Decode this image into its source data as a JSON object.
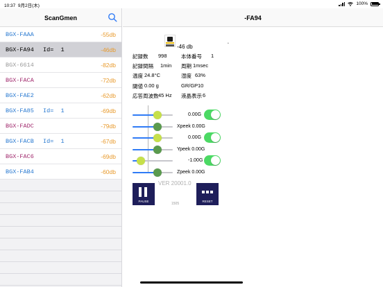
{
  "status_bar": {
    "time": "10:37",
    "date": "9月2日(木)",
    "battery": "100%",
    "wifi_icon": "wifi-icon",
    "signal_icon": "signal-icon",
    "battery_icon": "battery-icon"
  },
  "sidebar": {
    "title": "ScanGmen",
    "search_icon": "search-icon",
    "devices": [
      {
        "name": "BGX-FAAA",
        "id": "",
        "signal": "-55db",
        "color": "#2a7ad1",
        "selected": false
      },
      {
        "name": "BGX-FA94",
        "id": "Id=  1",
        "signal": "-46db",
        "color": "#000000",
        "selected": true
      },
      {
        "name": "BGX-6614",
        "id": "",
        "signal": "-82db",
        "color": "#9a9a9a",
        "selected": false
      },
      {
        "name": "BGX-FACA",
        "id": "",
        "signal": "-72db",
        "color": "#a0286c",
        "selected": false
      },
      {
        "name": "BGX-FAE2",
        "id": "",
        "signal": "-62db",
        "color": "#2a7ad1",
        "selected": false
      },
      {
        "name": "BGX-FA85",
        "id": "Id=  1",
        "signal": "-69db",
        "color": "#2a7ad1",
        "selected": false
      },
      {
        "name": "BGX-FADC",
        "id": "",
        "signal": "-79db",
        "color": "#a0286c",
        "selected": false
      },
      {
        "name": "BGX-FACB",
        "id": "Id=  1",
        "signal": "-67db",
        "color": "#2a7ad1",
        "selected": false
      },
      {
        "name": "BGX-FAC6",
        "id": "",
        "signal": "-69db",
        "color": "#a0286c",
        "selected": false
      },
      {
        "name": "BGX-FAB4",
        "id": "",
        "signal": "-60db",
        "color": "#2a7ad1",
        "selected": false
      }
    ]
  },
  "main": {
    "title": "-FA94",
    "signal": "-46 db",
    "info": {
      "record_count_label": "記録数",
      "record_count": "998",
      "unit_no_label": "本体番号",
      "unit_no": "1",
      "record_interval_label": "記録間隔",
      "record_interval": "1min",
      "period_label": "周期",
      "period": "1msec",
      "temp_label": "温度",
      "temp": "24.8°C",
      "humidity_label": "湿度",
      "humidity": "63%",
      "threshold_label": "閾値",
      "threshold": "0.00 g",
      "grgp_label": "GR/GP",
      "grgp": "10",
      "resp_freq_label": "応答周波数",
      "resp_freq": "45 Hz",
      "lcd_label": "液晶表示",
      "lcd": "6"
    },
    "controls": [
      {
        "slider_value": 0.62,
        "thumb_color": "#c6e04a",
        "label": "0.00G",
        "toggle": true
      },
      {
        "slider_value": 0.62,
        "thumb_color": "#5a9a4e",
        "label": "Xpeek 0.00G",
        "toggle": false
      },
      {
        "slider_value": 0.62,
        "thumb_color": "#c6e04a",
        "label": "0.00G",
        "toggle": true
      },
      {
        "slider_value": 0.62,
        "thumb_color": "#5a9a4e",
        "label": "Ypeek 0.00G",
        "toggle": false
      },
      {
        "slider_value": 0.2,
        "thumb_color": "#c6e04a",
        "label": "-1.00G",
        "toggle": true
      },
      {
        "slider_value": 0.62,
        "thumb_color": "#5a9a4e",
        "label": "Zpeek 0.00G",
        "toggle": false
      }
    ],
    "version": "VER  20001.0",
    "pause_label": "PAUSE",
    "reset_label": "RESET",
    "counter": "1505"
  }
}
